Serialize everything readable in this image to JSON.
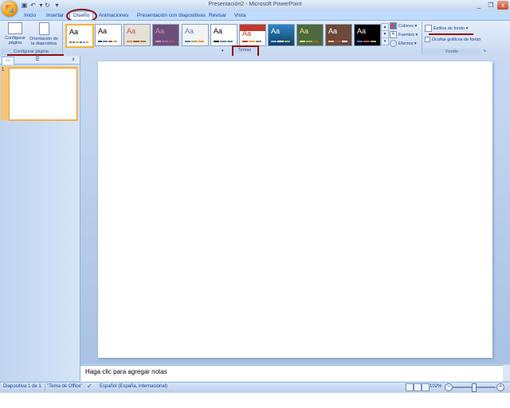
{
  "window": {
    "title": "Presentación2 - Microsoft PowerPoint"
  },
  "tabs": [
    "Inicio",
    "Insertar",
    "Diseño",
    "Animaciones",
    "Presentación con diapositivas",
    "Revisar",
    "Vista"
  ],
  "ribbon": {
    "page_setup": {
      "config_label": "Configurar página",
      "orientation_label": "Orientación de la diapositiva",
      "group_label": "Configurar página"
    },
    "themes": {
      "group_label": "Temas",
      "items": [
        {
          "label": "Aa",
          "bg": "#ffffff",
          "fg": "#000000"
        },
        {
          "label": "Aa",
          "bg": "#ffffff",
          "fg": "#000000"
        },
        {
          "label": "Aa",
          "bg": "#e7e0d6",
          "fg": "#c0504d"
        },
        {
          "label": "Aa",
          "bg": "#6b4f7a",
          "fg": "#e58fa5"
        },
        {
          "label": "Aa",
          "bg": "#f3f3f3",
          "fg": "#4f81bd"
        },
        {
          "label": "Aa",
          "bg": "#ffffff",
          "fg": "#000000"
        },
        {
          "label": "Aa",
          "bg": "#ffffff",
          "fg": "#c0392b"
        },
        {
          "label": "Aa",
          "bg": "#1f6fae",
          "fg": "#ffffff"
        },
        {
          "label": "Aa",
          "bg": "#4c6a3d",
          "fg": "#f4e27a"
        },
        {
          "label": "Aa",
          "bg": "#6b4a3a",
          "fg": "#ffffff"
        },
        {
          "label": "Aa",
          "bg": "#000000",
          "fg": "#ffffff"
        }
      ]
    },
    "theme_options": {
      "colors": "Colores",
      "fonts": "Fuentes",
      "effects": "Efectos"
    },
    "background": {
      "styles": "Estilos de fondo",
      "hide_graphics": "Ocultar gráficos de fondo",
      "group_label": "Fondo"
    }
  },
  "slides_pane": {
    "slide_number": "1"
  },
  "notes": {
    "placeholder": "Haga clic para agregar notas"
  },
  "status": {
    "slide": "Diapositiva 1 de 1",
    "theme": "\"Tema de Office\"",
    "language": "Español (España, internacional)",
    "zoom": "102%"
  },
  "colors": {
    "annotation": "#8b1214",
    "ribbon_text": "#15428b"
  }
}
